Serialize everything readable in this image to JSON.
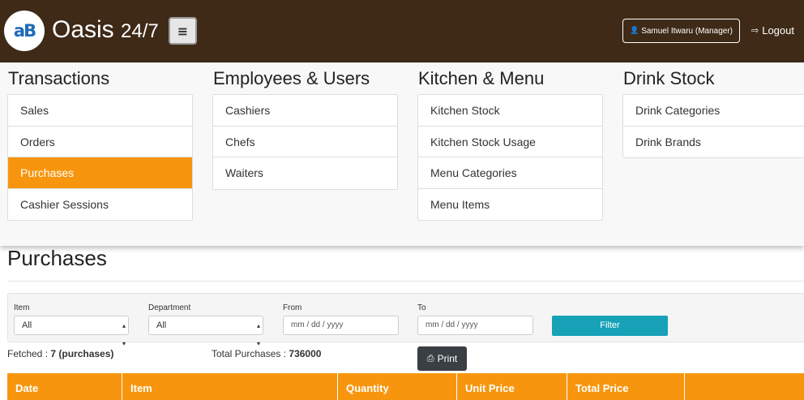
{
  "header": {
    "logo_text": "aB",
    "app_name": "Oasis",
    "app_suffix": "24/7",
    "menu_icon": "hamburger-icon",
    "user_icon": "user-icon",
    "user_label": "Samuel Itwaru (Manager)",
    "logout_icon": "logout-icon",
    "logout_label": "Logout"
  },
  "menu": {
    "transactions": {
      "title": "Transactions",
      "items": [
        "Sales",
        "Orders",
        "Purchases",
        "Cashier Sessions"
      ],
      "active": "Purchases"
    },
    "employees": {
      "title": "Employees & Users",
      "items": [
        "Cashiers",
        "Chefs",
        "Waiters"
      ]
    },
    "kitchen": {
      "title": "Kitchen & Menu",
      "items": [
        "Kitchen Stock",
        "Kitchen Stock Usage",
        "Menu Categories",
        "Menu Items"
      ]
    },
    "drinks": {
      "title": "Drink Stock",
      "items": [
        "Drink Categories",
        "Drink Brands"
      ]
    }
  },
  "page": {
    "title": "Purchases"
  },
  "filters": {
    "item_label": "Item",
    "item_value": "All",
    "department_label": "Department",
    "department_value": "All",
    "from_label": "From",
    "from_placeholder": "mm / dd / yyyy",
    "to_label": "To",
    "to_placeholder": "mm / dd / yyyy",
    "filter_label": "Filter"
  },
  "summary": {
    "fetched_prefix": "Fetched :",
    "fetched_value": "7 (purchases)",
    "total_prefix": "Total Purchases :",
    "total_value": "736000",
    "print_icon": "printer-icon",
    "print_label": "Print"
  },
  "table": {
    "columns": [
      "Date",
      "Item",
      "Quantity",
      "Unit Price",
      "Total Price",
      ""
    ]
  },
  "colors": {
    "header_bg": "#3e2a17",
    "accent_orange": "#f7960e",
    "filter_button": "#17a2b8",
    "print_button": "#3a3f44"
  }
}
